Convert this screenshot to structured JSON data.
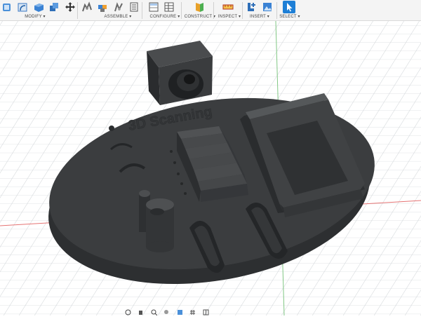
{
  "toolbar": {
    "groups": [
      {
        "label": "MODIFY ▾"
      },
      {
        "label": "ASSEMBLE ▾"
      },
      {
        "label": "CONFIGURE ▾"
      },
      {
        "label": "CONSTRUCT ▾"
      },
      {
        "label": "INSPECT ▾"
      },
      {
        "label": "INSERT ▾"
      },
      {
        "label": "SELECT ▾"
      }
    ],
    "icons": {
      "modify": [
        "press-pull-icon",
        "fillet-icon",
        "shell-icon",
        "combine-icon",
        "move-icon"
      ],
      "assemble": [
        "joint-icon",
        "new-component-icon",
        "as-built-joint-icon",
        "rigid-group-icon"
      ],
      "configure": [
        "configure-table-icon",
        "table-icon"
      ],
      "construct": [
        "offset-plane-icon"
      ],
      "inspect": [
        "measure-icon"
      ],
      "insert": [
        "insert-derive-icon",
        "insert-image-icon"
      ],
      "select": [
        "select-cursor-icon"
      ]
    }
  },
  "viewport": {
    "model_text": "3D Scanning",
    "colors": {
      "model": "#3d3f41",
      "model_dark": "#2a2c2e",
      "model_light": "#55585a",
      "grid": "#c9cdd1",
      "accent": "#1e7fd6"
    }
  },
  "navbar": {
    "icons": [
      "orbit-icon",
      "pan-icon",
      "zoom-icon",
      "fit-icon",
      "display-settings-icon",
      "grid-settings-icon",
      "viewports-icon"
    ]
  }
}
